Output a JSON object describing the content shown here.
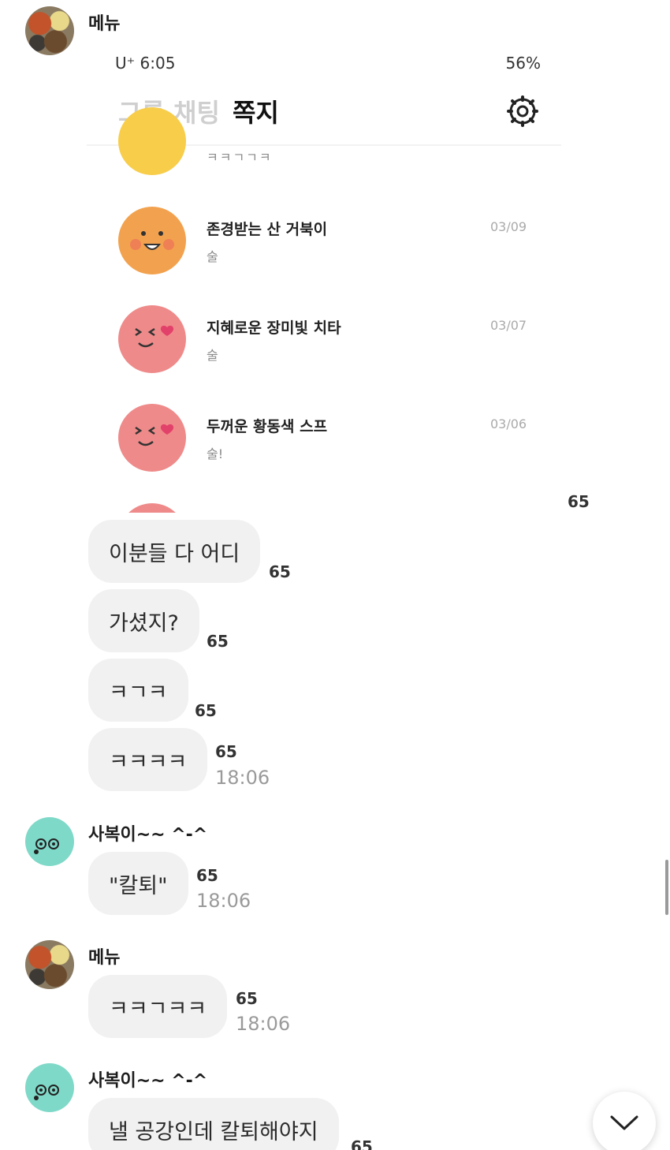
{
  "messages": {
    "top_sender": {
      "name": "메뉴"
    },
    "screenshot": {
      "status_time": "U⁺ 6:05",
      "status_battery": "56%",
      "tab_group": "그룹 채팅",
      "tab_note": "쪽지",
      "rows": [
        {
          "title": "",
          "preview": "ㅋㅋㄱㄱㅋ",
          "date": ""
        },
        {
          "title": "존경받는 산 거북이",
          "preview": "술",
          "date": "03/09"
        },
        {
          "title": "지혜로운 장미빛 치타",
          "preview": "술",
          "date": "03/07"
        },
        {
          "title": "두꺼운 황동색 스프",
          "preview": "술!",
          "date": "03/06"
        }
      ],
      "count": "65"
    },
    "bubbles": [
      {
        "text": "이분들 다 어디",
        "count": "65"
      },
      {
        "text": "가셨지?",
        "count": "65"
      },
      {
        "text": "ㅋㄱㅋ",
        "count": "65"
      },
      {
        "text": "ㅋㅋㅋㅋ",
        "count": "65",
        "time": "18:06"
      }
    ],
    "sabok1": {
      "name": "사복이~~ ^-^",
      "text": "\"칼퇴\"",
      "count": "65",
      "time": "18:06"
    },
    "menu2": {
      "name": "메뉴",
      "text": "ㅋㅋㄱㅋㅋ",
      "count": "65",
      "time": "18:06"
    },
    "sabok2": {
      "name": "사복이~~ ^-^",
      "text": "낼 공강인데 칼퇴해야지",
      "count": "65"
    }
  },
  "icons": {
    "gear": "gear-icon",
    "scroll_down": "chevron-down-icon"
  }
}
